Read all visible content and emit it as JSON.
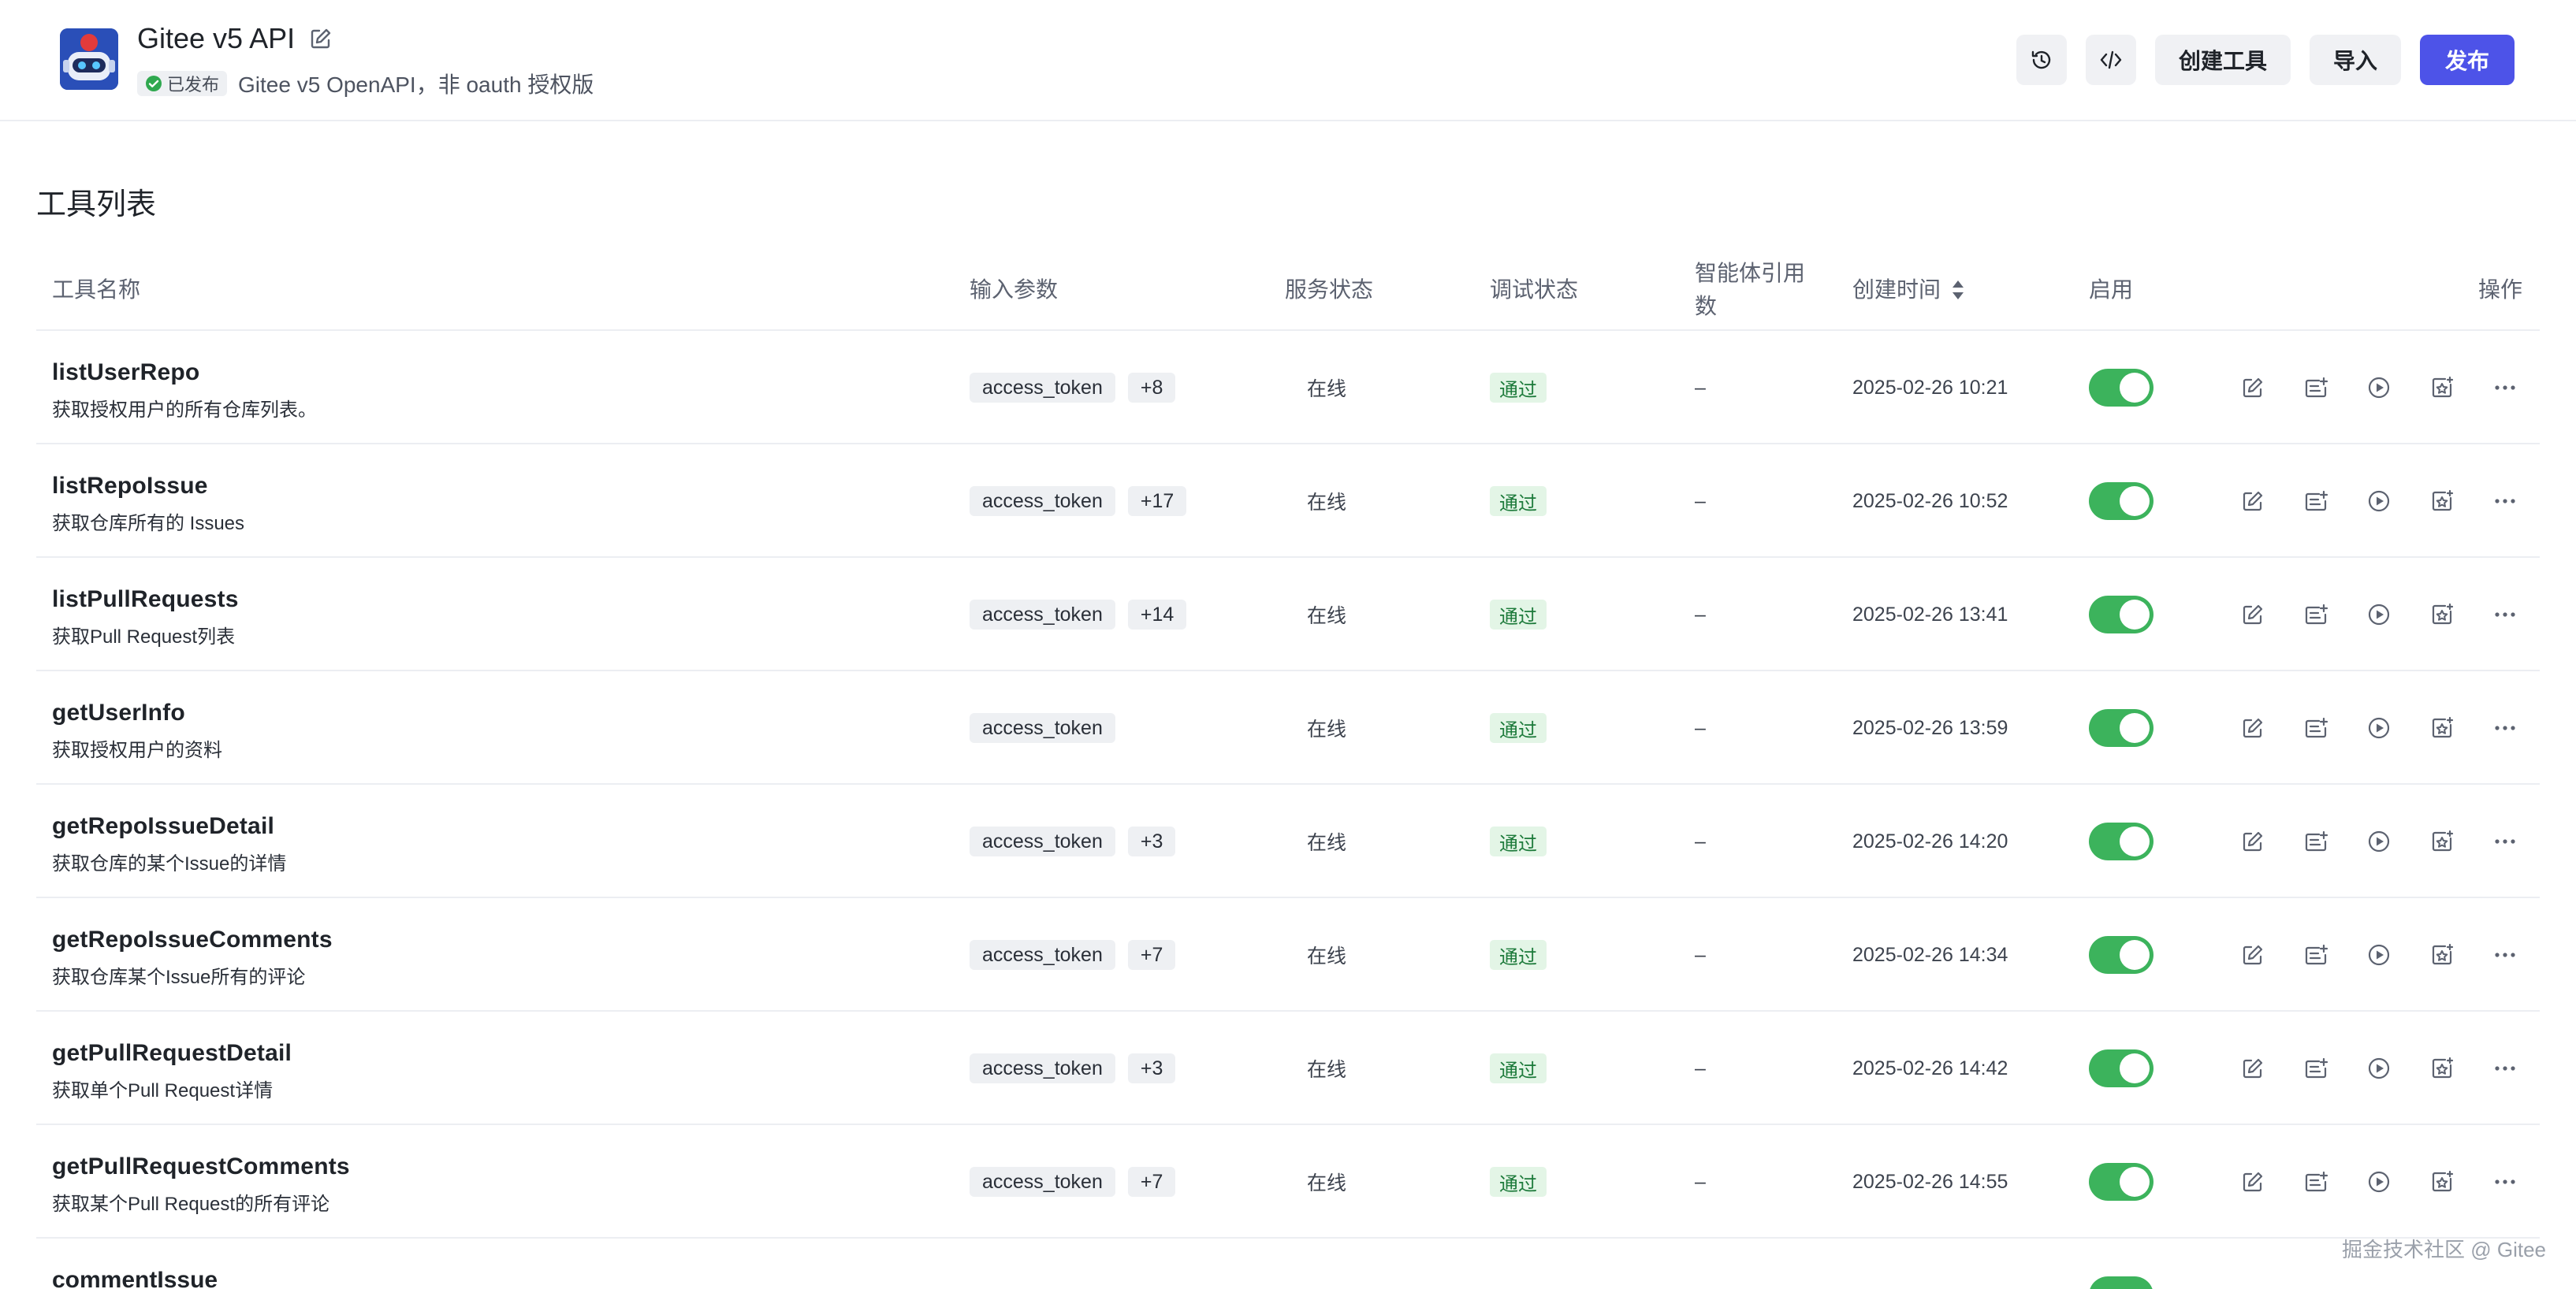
{
  "header": {
    "title": "Gitee v5 API",
    "badge": "已发布",
    "description": "Gitee v5 OpenAPI，非 oauth 授权版",
    "actions": {
      "create_tool": "创建工具",
      "import": "导入",
      "publish": "发布"
    }
  },
  "section": {
    "title": "工具列表"
  },
  "table": {
    "headers": {
      "name": "工具名称",
      "params": "输入参数",
      "service_status": "服务状态",
      "debug_status": "调试状态",
      "agent_refs": "智能体引用数",
      "created_time": "创建时间",
      "enabled": "启用",
      "actions": "操作"
    },
    "rows": [
      {
        "name": "listUserRepo",
        "desc": "获取授权用户的所有仓库列表。",
        "param": "access_token",
        "extra": "+8",
        "service": "在线",
        "debug": "通过",
        "refs": "–",
        "time": "2025-02-26 10:21"
      },
      {
        "name": "listRepoIssue",
        "desc": "获取仓库所有的 Issues",
        "param": "access_token",
        "extra": "+17",
        "service": "在线",
        "debug": "通过",
        "refs": "–",
        "time": "2025-02-26 10:52"
      },
      {
        "name": "listPullRequests",
        "desc": "获取Pull Request列表",
        "param": "access_token",
        "extra": "+14",
        "service": "在线",
        "debug": "通过",
        "refs": "–",
        "time": "2025-02-26 13:41"
      },
      {
        "name": "getUserInfo",
        "desc": "获取授权用户的资料",
        "param": "access_token",
        "extra": "",
        "service": "在线",
        "debug": "通过",
        "refs": "–",
        "time": "2025-02-26 13:59"
      },
      {
        "name": "getRepoIssueDetail",
        "desc": "获取仓库的某个Issue的详情",
        "param": "access_token",
        "extra": "+3",
        "service": "在线",
        "debug": "通过",
        "refs": "–",
        "time": "2025-02-26 14:20"
      },
      {
        "name": "getRepoIssueComments",
        "desc": "获取仓库某个Issue所有的评论",
        "param": "access_token",
        "extra": "+7",
        "service": "在线",
        "debug": "通过",
        "refs": "–",
        "time": "2025-02-26 14:34"
      },
      {
        "name": "getPullRequestDetail",
        "desc": "获取单个Pull Request详情",
        "param": "access_token",
        "extra": "+3",
        "service": "在线",
        "debug": "通过",
        "refs": "–",
        "time": "2025-02-26 14:42"
      },
      {
        "name": "getPullRequestComments",
        "desc": "获取某个Pull Request的所有评论",
        "param": "access_token",
        "extra": "+7",
        "service": "在线",
        "debug": "通过",
        "refs": "–",
        "time": "2025-02-26 14:55"
      }
    ],
    "partial_row_name": "commentIssue"
  },
  "watermark": "掘金技术社区 @ Gitee",
  "colors": {
    "primary": "#4d53e8",
    "toggle_on": "#3cb35c",
    "pass_bg": "#e3f5e6",
    "pass_text": "#1c7a3a"
  }
}
